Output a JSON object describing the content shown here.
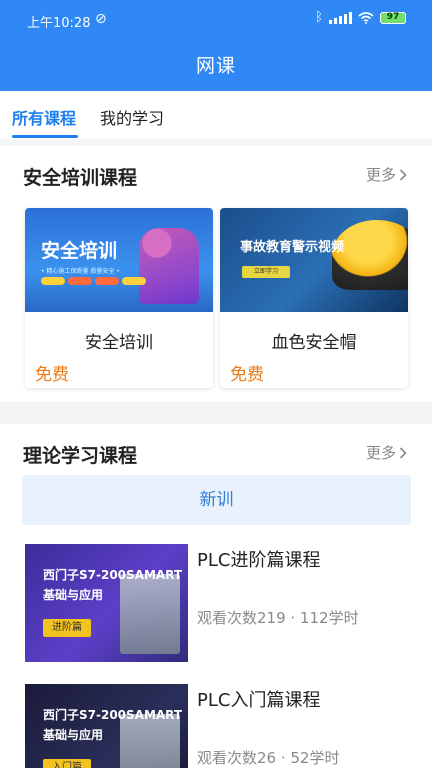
{
  "status_bar": {
    "time": "上午10:28",
    "battery": "97",
    "alarm_icon": "alarm-off-icon",
    "bluetooth_icon": "bluetooth-icon",
    "signal_icon": "signal-icon",
    "wifi_icon": "wifi-icon"
  },
  "header": {
    "title": "网课"
  },
  "tabs": [
    {
      "label": "所有课程",
      "active": true
    },
    {
      "label": "我的学习",
      "active": false
    }
  ],
  "safety_section": {
    "title": "安全培训课程",
    "more": "更多",
    "courses": [
      {
        "thumb_text": "安全培训",
        "thumb_sub": "• 精心施工保质量 质量安全 •",
        "name": "安全培训",
        "price": "免费"
      },
      {
        "thumb_text": "事故教育警示视频",
        "thumb_button": "立即学习",
        "name": "血色安全帽",
        "price": "免费"
      }
    ]
  },
  "theory_section": {
    "title": "理论学习课程",
    "more": "更多",
    "filter": "新训",
    "courses": [
      {
        "thumb_line1": "西门子S7-200SAMART",
        "thumb_line2": "基础与应用",
        "thumb_tag": "进阶篇",
        "name": "PLC进阶篇课程",
        "meta": "观看次数219 · 112学时"
      },
      {
        "thumb_line1": "西门子S7-200SAMART",
        "thumb_line2": "基础与应用",
        "thumb_tag": "入门篇",
        "name": "PLC入门篇课程",
        "meta": "观看次数26 · 52学时"
      }
    ]
  },
  "colors": {
    "primary": "#2f88f4",
    "accent_tab": "#1e7ff0",
    "price": "#f07a12",
    "filter_bg": "#e9f2fc"
  }
}
